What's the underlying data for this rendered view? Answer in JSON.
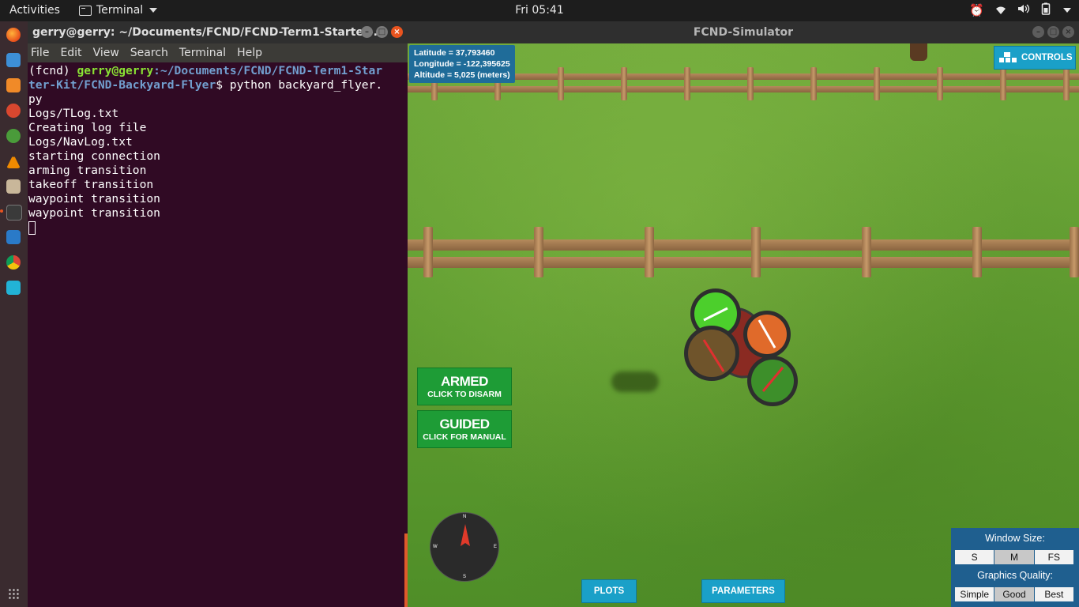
{
  "topbar": {
    "activities": "Activities",
    "app_name": "Terminal",
    "clock": "Fri 05:41",
    "tray_icons": [
      "alarm-clock-icon",
      "wifi-icon",
      "volume-icon",
      "battery-icon",
      "power-menu-caret-icon"
    ]
  },
  "dock": {
    "items": [
      "firefox",
      "document-viewer",
      "software-center",
      "settings",
      "help",
      "vlc",
      "files",
      "terminal",
      "vscode",
      "chrome",
      "pycharm"
    ],
    "active": "terminal"
  },
  "terminal": {
    "title": "gerry@gerry: ~/Documents/FCND/FCND-Term1-Starter-...",
    "menu": [
      "File",
      "Edit",
      "View",
      "Search",
      "Terminal",
      "Help"
    ],
    "prompt_env": "(fcnd) ",
    "prompt_user": "gerry@gerry",
    "prompt_path_l1": ":~/Documents/FCND/FCND-Term1-Star",
    "prompt_path_l2": "ter-Kit/FCND-Backyard-Flyer",
    "prompt_cmd": "$ python backyard_flyer.",
    "output": [
      "py",
      "Logs/TLog.txt",
      "Creating log file",
      "Logs/NavLog.txt",
      "starting connection",
      "arming transition",
      "takeoff transition",
      "waypoint transition",
      "waypoint transition"
    ]
  },
  "simulator": {
    "title": "FCND-Simulator",
    "latitude": "Latitude = 37,793460",
    "longitude": "Longitude = -122,395625",
    "altitude": "Altitude = 5,025 (meters)",
    "controls_label": "CONTROLS",
    "armed_label": "ARMED",
    "armed_sub": "CLICK TO DISARM",
    "guided_label": "GUIDED",
    "guided_sub": "CLICK FOR MANUAL",
    "compass": {
      "n": "N",
      "s": "S",
      "e": "E",
      "w": "W"
    },
    "plots_label": "PLOTS",
    "parameters_label": "PARAMETERS",
    "window_size_label": "Window Size:",
    "window_sizes": [
      "S",
      "M",
      "FS"
    ],
    "window_size_selected": "M",
    "graphics_quality_label": "Graphics Quality:",
    "graphics_qualities": [
      "Simple",
      "Good",
      "Best"
    ],
    "graphics_quality_selected": "Good",
    "colors": {
      "armed": "#1e9c36",
      "controls": "#1aa0c8",
      "panel": "#1f5f8f"
    }
  }
}
